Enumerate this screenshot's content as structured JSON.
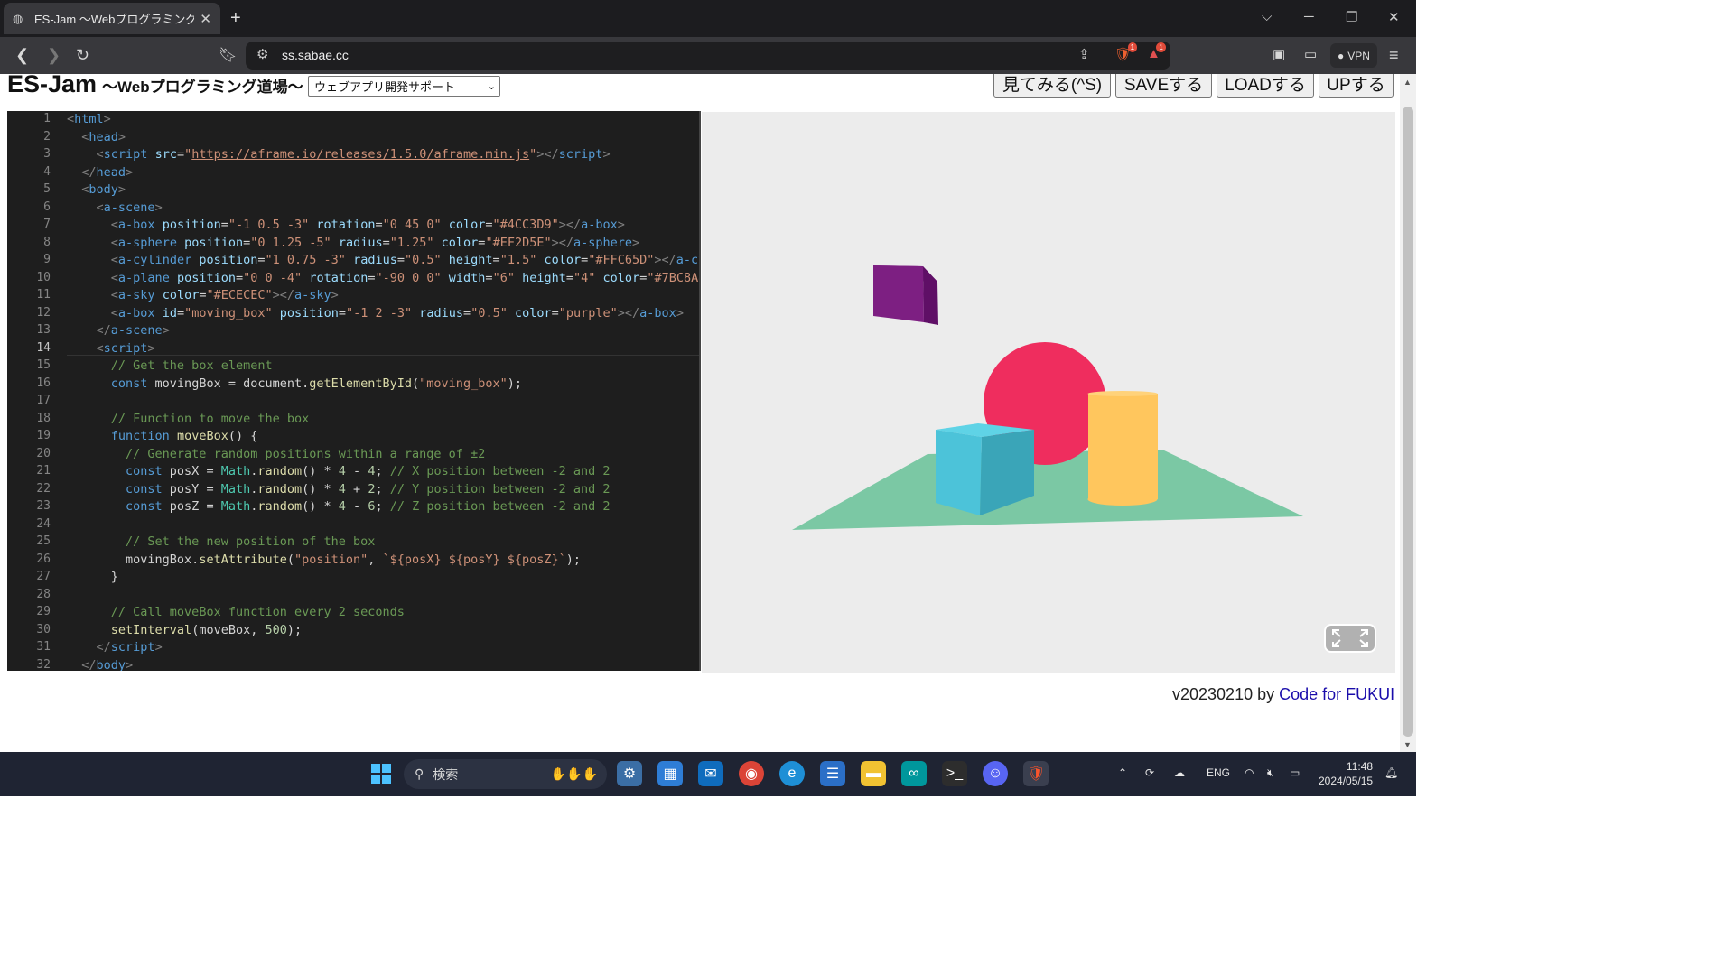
{
  "browser": {
    "tab_title": "ES-Jam 〜Webプログラミング道場〜",
    "new_tab": "+",
    "url": "ss.sabae.cc",
    "vpn_label": "VPN",
    "brave_badge": "1",
    "alert_badge": "1"
  },
  "header": {
    "title": "ES-Jam",
    "subtitle": "〜Webプログラミング道場〜",
    "mode_select": "ウェブアプリ開発サポート",
    "buttons": {
      "view": "見てみる(^S)",
      "save": "SAVEする",
      "load": "LOADする",
      "up": "UPする"
    }
  },
  "editor": {
    "active_line": 14,
    "line_numbers": [
      "1",
      "2",
      "3",
      "4",
      "5",
      "6",
      "7",
      "8",
      "9",
      "10",
      "11",
      "12",
      "13",
      "14",
      "15",
      "16",
      "17",
      "18",
      "19",
      "20",
      "21",
      "22",
      "23",
      "24",
      "25",
      "26",
      "27",
      "28",
      "29",
      "30",
      "31",
      "32"
    ]
  },
  "preview": {
    "background": "#ECECEC",
    "objects": [
      {
        "type": "box",
        "color": "#4CC3D9"
      },
      {
        "type": "sphere",
        "color": "#EF2D5E"
      },
      {
        "type": "cylinder",
        "color": "#FFC65D"
      },
      {
        "type": "plane",
        "color": "#7BC8A4"
      },
      {
        "type": "box",
        "id": "moving_box",
        "color": "purple"
      }
    ]
  },
  "footer": {
    "version": "v20230210 by ",
    "link": "Code for FUKUI"
  },
  "taskbar": {
    "search_placeholder": "検索",
    "lang": "ENG",
    "time": "11:48",
    "date": "2024/05/15"
  }
}
